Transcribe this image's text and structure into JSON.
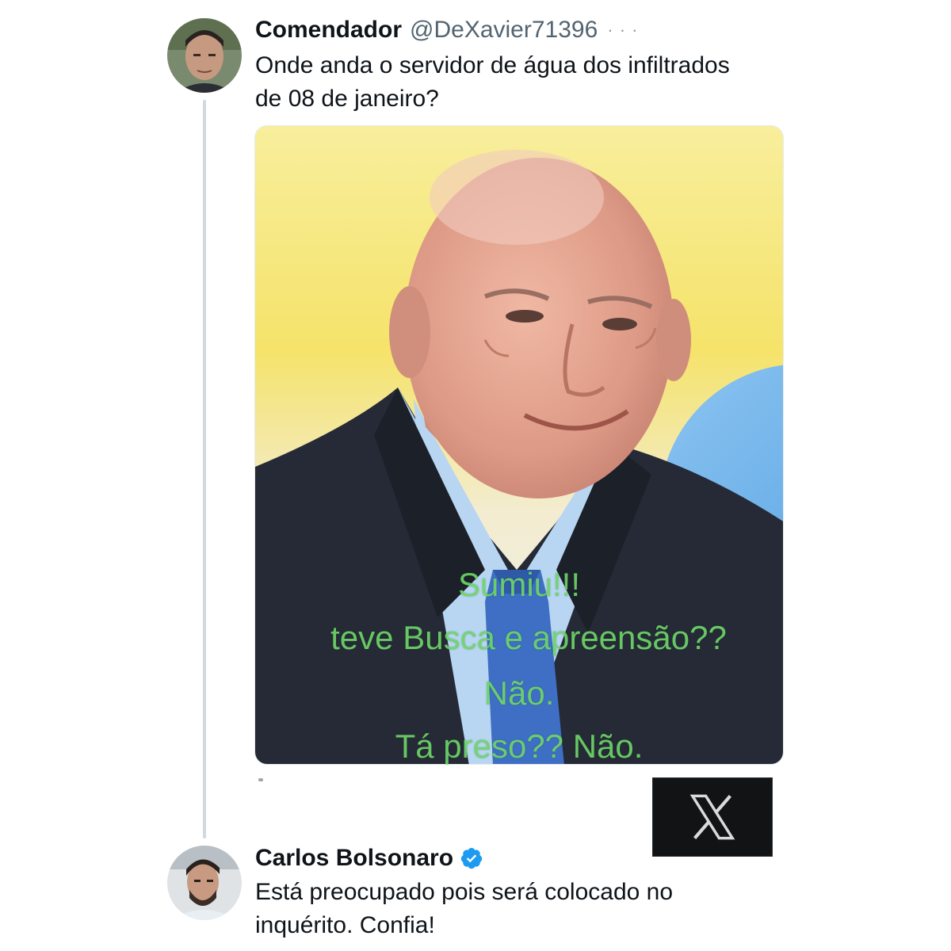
{
  "thread": {
    "tweet1": {
      "name": "Comendador",
      "handle": "@DeXavier71396",
      "text_line1": "Onde anda o servidor de água dos infiltrados",
      "text_line2": "de 08 de janeiro?",
      "avatar_icon": "profile-photo",
      "media": {
        "overlay_line1": "Sumiu!!!",
        "overlay_line2": "teve Busca e apreensão??",
        "overlay_line3": "Não.",
        "overlay_line4": "Tá preso?? Não."
      }
    },
    "tweet2": {
      "name": "Carlos Bolsonaro",
      "verified": true,
      "verified_icon": "verified-badge-icon",
      "text_line1": "Está preocupado pois será colocado no",
      "text_line2": "inquérito. Confia!",
      "avatar_icon": "profile-photo"
    }
  },
  "watermark": {
    "icon": "x-logo-icon"
  },
  "colors": {
    "text": "#0f1419",
    "secondary": "#536471",
    "verified": "#1d9bf0",
    "thread_line": "#cfd9de",
    "overlay_text": "#6ed46a"
  }
}
